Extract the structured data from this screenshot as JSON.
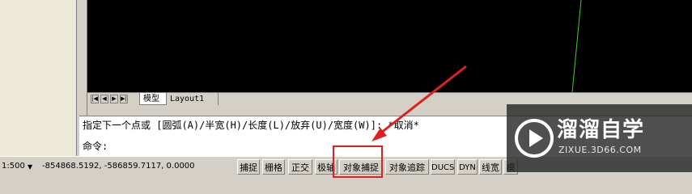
{
  "tabs": {
    "nav_first": "|◀",
    "nav_prev": "◀",
    "nav_next": "▶",
    "nav_last": "▶|",
    "model": "模型",
    "layout1": "Layout1"
  },
  "command": {
    "line1": "指定下一个点或 [圆弧(A)/半宽(H)/长度(L)/放弃(U)/宽度(W)]: *取消*",
    "prompt": "命令:"
  },
  "status": {
    "scale": "1:500",
    "coords": "-854868.5192, -586859.7117, 0.0000",
    "buttons": [
      "捕捉",
      "栅格",
      "正交",
      "极轴",
      "对象捕捉",
      "对象追踪",
      "DUCS",
      "DYN",
      "线宽",
      "模"
    ]
  },
  "watermark": {
    "title": "溜溜自学",
    "url": "ZIXUE.3D66.COM"
  },
  "colors": {
    "annotation": "#e02020",
    "drawing_line": "#3fd12d"
  }
}
